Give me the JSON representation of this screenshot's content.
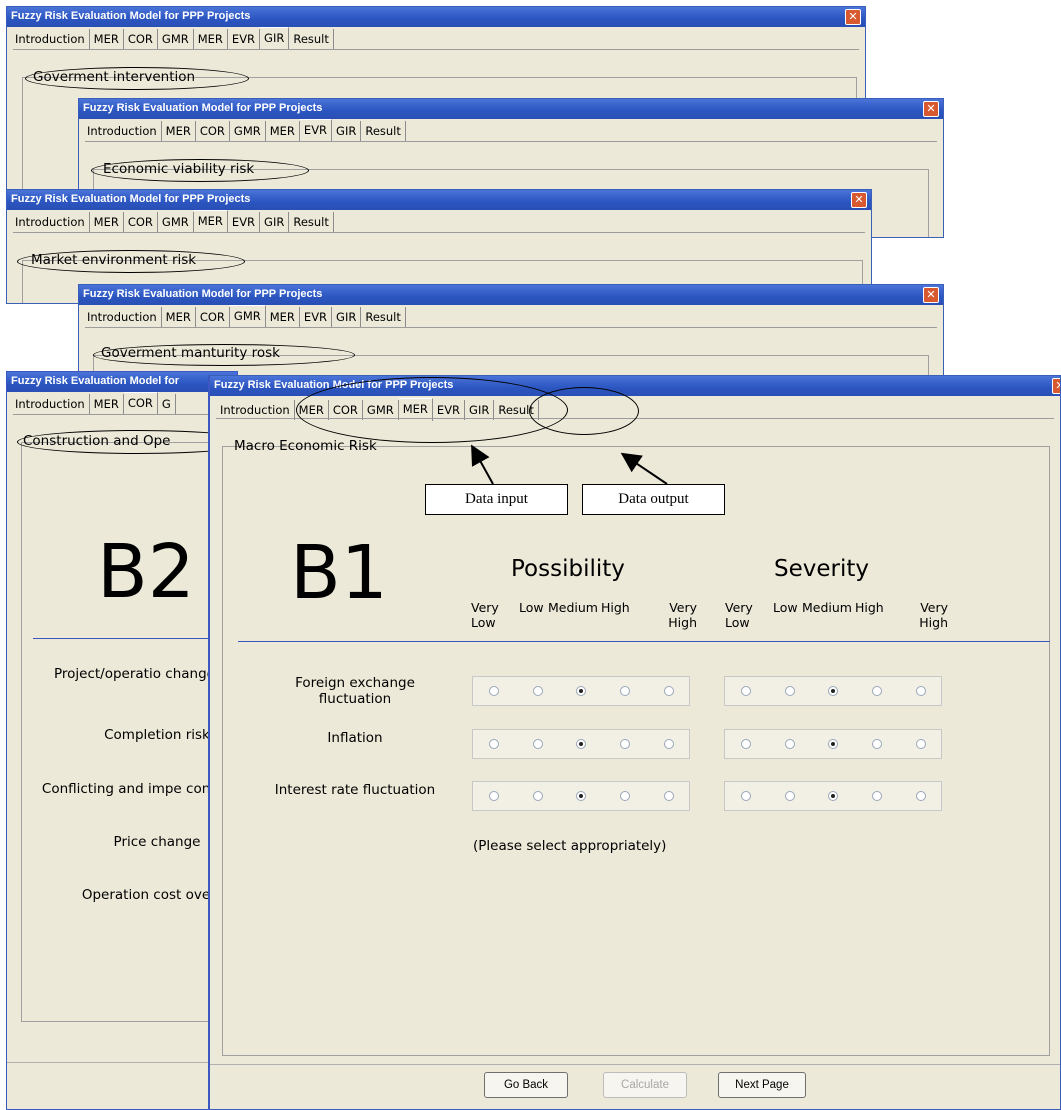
{
  "window_title": "Fuzzy Risk Evaluation Model for PPP Projects",
  "close_glyph": "✕",
  "win_gir": {
    "tabs": [
      "Introduction",
      "MER",
      "COR",
      "GMR",
      "MER",
      "EVR",
      "GIR",
      "Result"
    ],
    "active_tab": "GIR",
    "group_title": "Goverment intervention"
  },
  "win_evr": {
    "tabs": [
      "Introduction",
      "MER",
      "COR",
      "GMR",
      "MER",
      "EVR",
      "GIR",
      "Result"
    ],
    "active_tab": "EVR",
    "group_title": "Economic viability risk"
  },
  "win_mer": {
    "tabs": [
      "Introduction",
      "MER",
      "COR",
      "GMR",
      "MER",
      "EVR",
      "GIR",
      "Result"
    ],
    "active_tab": "MER",
    "group_title": "Market environment risk"
  },
  "win_gmr": {
    "tabs": [
      "Introduction",
      "MER",
      "COR",
      "GMR",
      "MER",
      "EVR",
      "GIR",
      "Result"
    ],
    "active_tab": "GMR",
    "group_title": "Goverment manturity rosk"
  },
  "win_cor": {
    "title_visible": "Fuzzy Risk Evaluation Model for",
    "tabs_visible": [
      "Introduction",
      "MER",
      "COR",
      "G"
    ],
    "active_tab": "COR",
    "group_title": "Construction and Ope",
    "label": "B2",
    "items": [
      "Project/operatio changes",
      "Completion risk",
      "Conflicting and impe contract",
      "Price change",
      "Operation cost ove"
    ]
  },
  "win_main": {
    "tabs": [
      "Introduction",
      "MER",
      "COR",
      "GMR",
      "MER",
      "EVR",
      "GIR",
      "Result"
    ],
    "active_tab": "MER",
    "group_title": "Macro Economic Risk",
    "label": "B1",
    "possibility_heading": "Possibility",
    "severity_heading": "Severity",
    "scale": [
      "Very Low",
      "Low",
      "Medium",
      "High",
      "Very High"
    ],
    "rows": [
      {
        "label": "Foreign exchange fluctuation",
        "possibility": "Medium",
        "severity": "Medium"
      },
      {
        "label": "Inflation",
        "possibility": "Medium",
        "severity": "Medium"
      },
      {
        "label": "Interest rate fluctuation",
        "possibility": "Medium",
        "severity": "Medium"
      }
    ],
    "note": "(Please select appropriately)",
    "buttons": {
      "go_back": "Go Back",
      "calculate": "Calculate",
      "next_page": "Next Page"
    }
  },
  "callouts": {
    "data_input": "Data input",
    "data_output": "Data output"
  },
  "colors": {
    "titlebar": "#2b55c0",
    "window_bg": "#ece9d8",
    "close_button": "#d8582f",
    "rule": "#3b58c2"
  }
}
